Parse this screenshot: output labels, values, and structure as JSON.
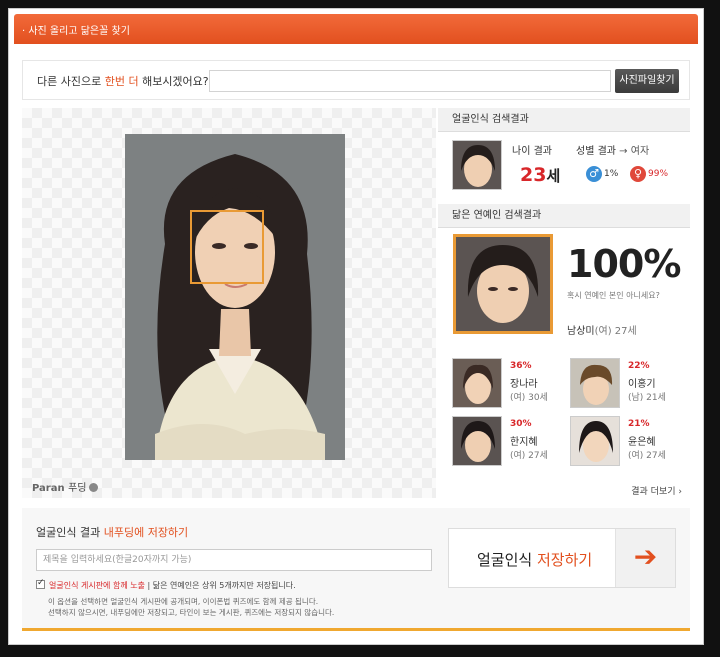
{
  "header": {
    "title": "· 사진 올리고 닮은꼴 찾기"
  },
  "search": {
    "prompt_a": "다른 사진으로 ",
    "prompt_b": "한번 더",
    "prompt_c": " 해보시겠어요?",
    "button": "사진파일찾기"
  },
  "photo": {
    "brand": "Paran",
    "brand_sub": "푸딩"
  },
  "face_result": {
    "title": "얼굴인식 검색결과",
    "age_label": "나이 결과",
    "age_value": "23",
    "age_unit": "세",
    "sex_label": "성별 결과",
    "sex_arrow": "→",
    "sex_value": "여자",
    "male_pct": "1%",
    "female_pct": "99%",
    "colors": {
      "male": "#3a8fd6",
      "female": "#e0483a"
    },
    "icons": {
      "male": "male-symbol-icon",
      "female": "female-symbol-icon"
    }
  },
  "celeb_result": {
    "title": "닮은 연예인 검색결과",
    "top_pct": "100%",
    "question": "혹시 연예인 본인 아니세요?",
    "top_name": "남상미",
    "top_meta": "(여)  27세",
    "items": [
      {
        "pct": "36%",
        "name": "장나라",
        "meta": "(여) 30세"
      },
      {
        "pct": "22%",
        "name": "이홍기",
        "meta": "(남) 21세"
      },
      {
        "pct": "30%",
        "name": "한지혜",
        "meta": "(여) 27세"
      },
      {
        "pct": "21%",
        "name": "윤은혜",
        "meta": "(여) 27세"
      }
    ],
    "more": "결과 더보기  ›"
  },
  "save": {
    "title_a": "얼굴인식 결과 ",
    "title_b": "내푸딩에 저장하기",
    "placeholder": "제목을 입력하세요(한글20자까지 가능)",
    "check_label": "얼굴인식 게시판에 함께 노출",
    "check_sep": "  |  닮은 연예인은 상위 5개까지만 저장됩니다.",
    "note1": "이 옵션을 선택하면 얼굴인식 게시판에 공개되며, 이이폰법 퀴즈에도 함께 제공 됩니다.",
    "note2": "선택하지 않으시면, 내푸딩에만 저장되고, 타인이 보는 게시판, 퀴즈에는 저장되지 않습니다.",
    "button_a": "얼굴인식 ",
    "button_b": "저장하기",
    "arrow": "➔"
  }
}
